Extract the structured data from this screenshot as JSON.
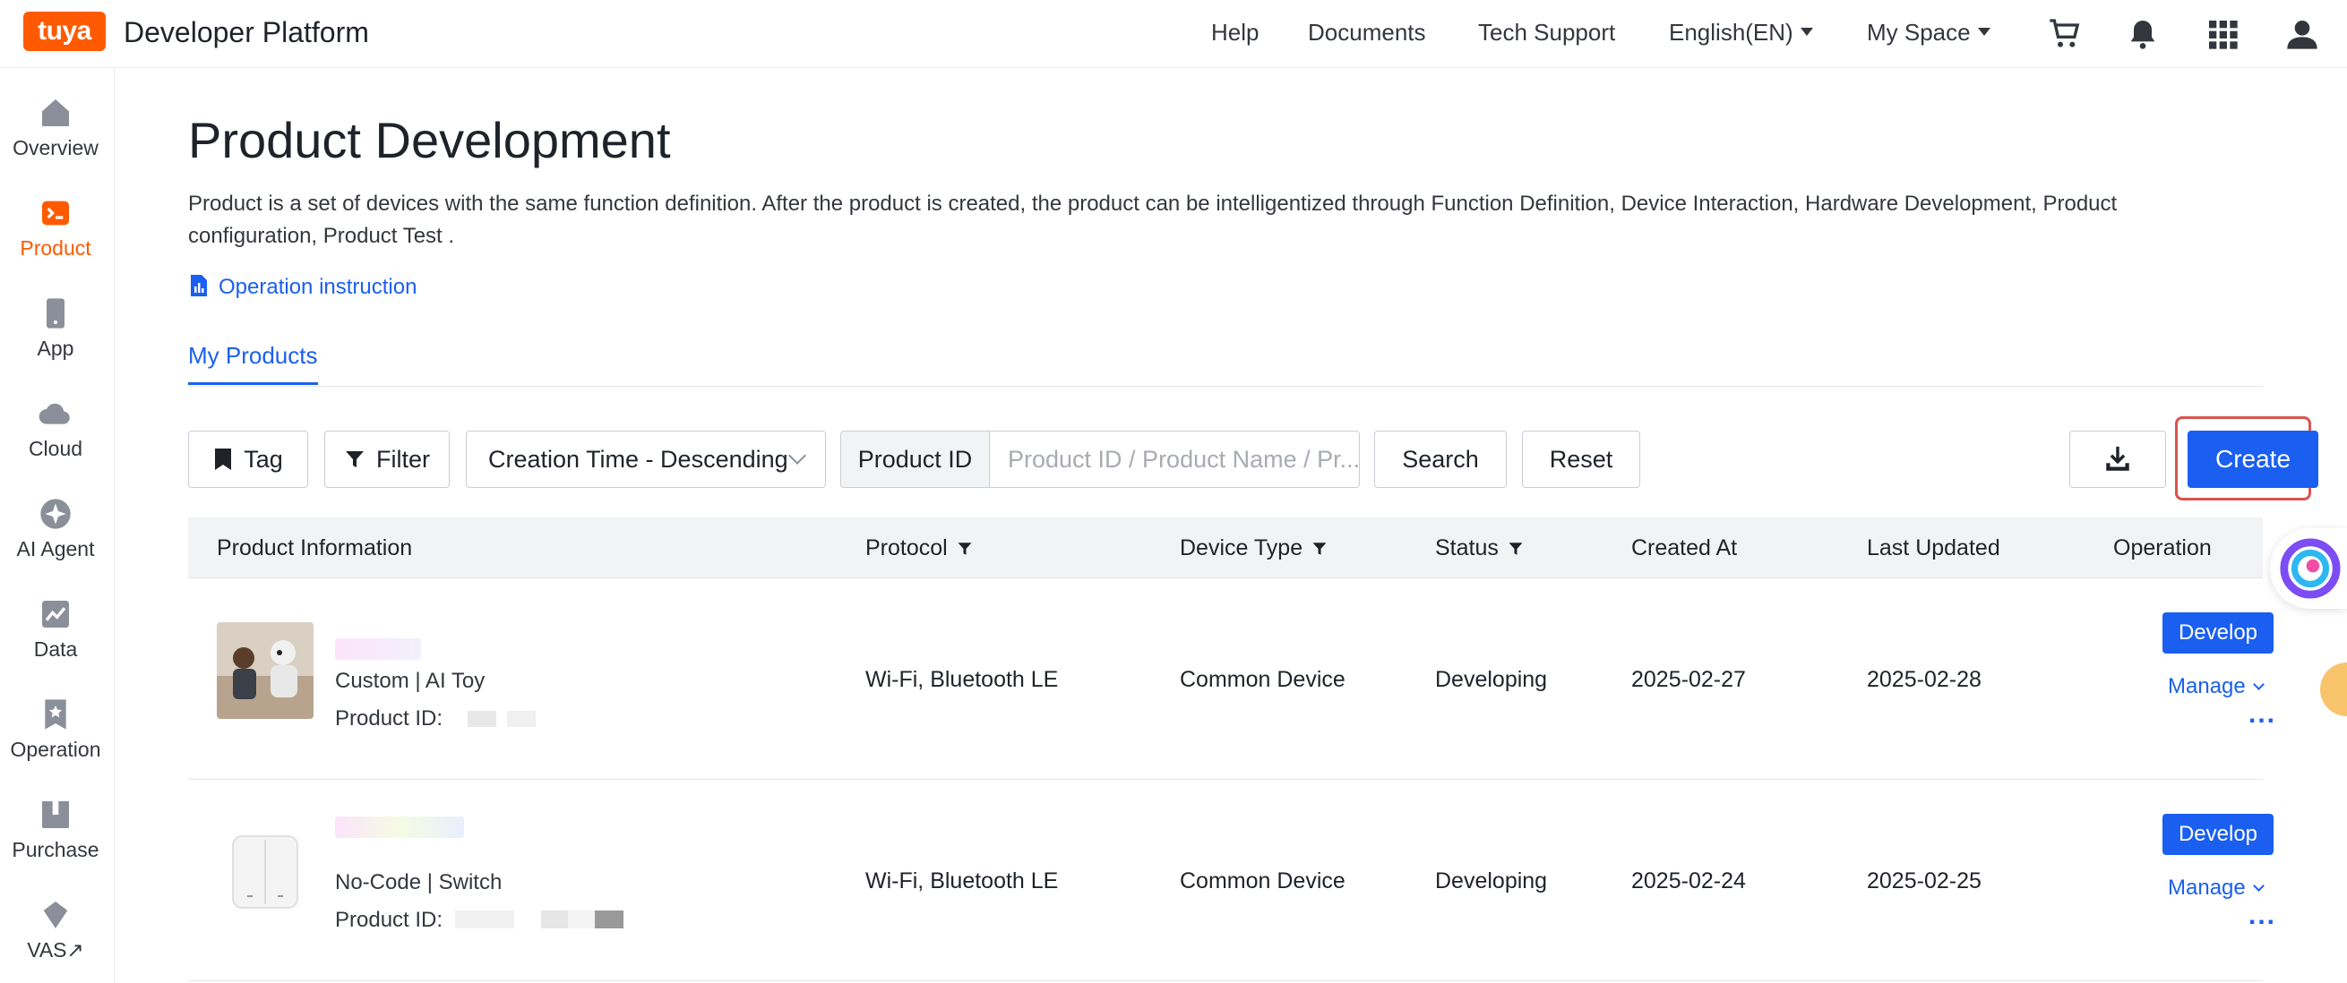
{
  "header": {
    "logo_text": "tuya",
    "brand": "Developer Platform",
    "nav": [
      "Help",
      "Documents",
      "Tech Support"
    ],
    "language": "English(EN)",
    "space": "My Space",
    "icons": [
      "cart-icon",
      "bell-icon",
      "grid-apps-icon",
      "user-icon"
    ]
  },
  "sidebar": {
    "items": [
      {
        "label": "Overview",
        "icon": "home-icon"
      },
      {
        "label": "Product",
        "icon": "terminal-icon",
        "active": true
      },
      {
        "label": "App",
        "icon": "phone-icon"
      },
      {
        "label": "Cloud",
        "icon": "cloud-icon"
      },
      {
        "label": "AI Agent",
        "icon": "sparkle-icon"
      },
      {
        "label": "Data",
        "icon": "chart-icon"
      },
      {
        "label": "Operation",
        "icon": "bookmark-star-icon"
      },
      {
        "label": "Purchase",
        "icon": "box-icon"
      },
      {
        "label": "VAS",
        "icon": "diamond-icon",
        "external_mark": "↗"
      }
    ]
  },
  "page": {
    "title": "Product Development",
    "description": "Product is a set of devices with the same function definition. After the product is created, the product can be intelligentized through Function Definition, Device Interaction, Hardware Development, Product configuration, Product Test .",
    "operation_link": "Operation instruction",
    "tab": "My Products"
  },
  "toolbar": {
    "tag": "Tag",
    "filter": "Filter",
    "sort_value": "Creation Time - Descending",
    "search_label": "Product ID",
    "search_placeholder": "Product ID / Product Name / Pr...",
    "search": "Search",
    "reset": "Reset",
    "create": "Create"
  },
  "table": {
    "columns": [
      "Product Information",
      "Protocol",
      "Device Type",
      "Status",
      "Created At",
      "Last Updated",
      "Operation"
    ],
    "rows": [
      {
        "category": "Custom  |  AI Toy",
        "pid_label": "Product ID:",
        "protocol": "Wi-Fi, Bluetooth LE",
        "device_type": "Common Device",
        "status": "Developing",
        "created": "2025-02-27",
        "updated": "2025-02-28",
        "develop": "Develop",
        "manage": "Manage",
        "more": "..."
      },
      {
        "category": "No-Code  |  Switch",
        "pid_label": "Product ID:",
        "protocol": "Wi-Fi, Bluetooth LE",
        "device_type": "Common Device",
        "status": "Developing",
        "created": "2025-02-24",
        "updated": "2025-02-25",
        "develop": "Develop",
        "manage": "Manage",
        "more": "..."
      }
    ]
  },
  "colors": {
    "accent": "#1a5ff0",
    "brand": "#ff5a00",
    "highlight": "#d9534f"
  }
}
